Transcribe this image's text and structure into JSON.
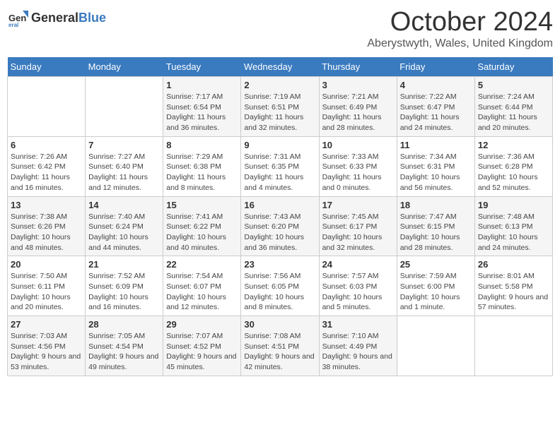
{
  "header": {
    "logo_general": "General",
    "logo_blue": "Blue",
    "month_title": "October 2024",
    "location": "Aberystwyth, Wales, United Kingdom"
  },
  "days_of_week": [
    "Sunday",
    "Monday",
    "Tuesday",
    "Wednesday",
    "Thursday",
    "Friday",
    "Saturday"
  ],
  "weeks": [
    [
      {
        "day": "",
        "detail": ""
      },
      {
        "day": "",
        "detail": ""
      },
      {
        "day": "1",
        "detail": "Sunrise: 7:17 AM\nSunset: 6:54 PM\nDaylight: 11 hours and 36 minutes."
      },
      {
        "day": "2",
        "detail": "Sunrise: 7:19 AM\nSunset: 6:51 PM\nDaylight: 11 hours and 32 minutes."
      },
      {
        "day": "3",
        "detail": "Sunrise: 7:21 AM\nSunset: 6:49 PM\nDaylight: 11 hours and 28 minutes."
      },
      {
        "day": "4",
        "detail": "Sunrise: 7:22 AM\nSunset: 6:47 PM\nDaylight: 11 hours and 24 minutes."
      },
      {
        "day": "5",
        "detail": "Sunrise: 7:24 AM\nSunset: 6:44 PM\nDaylight: 11 hours and 20 minutes."
      }
    ],
    [
      {
        "day": "6",
        "detail": "Sunrise: 7:26 AM\nSunset: 6:42 PM\nDaylight: 11 hours and 16 minutes."
      },
      {
        "day": "7",
        "detail": "Sunrise: 7:27 AM\nSunset: 6:40 PM\nDaylight: 11 hours and 12 minutes."
      },
      {
        "day": "8",
        "detail": "Sunrise: 7:29 AM\nSunset: 6:38 PM\nDaylight: 11 hours and 8 minutes."
      },
      {
        "day": "9",
        "detail": "Sunrise: 7:31 AM\nSunset: 6:35 PM\nDaylight: 11 hours and 4 minutes."
      },
      {
        "day": "10",
        "detail": "Sunrise: 7:33 AM\nSunset: 6:33 PM\nDaylight: 11 hours and 0 minutes."
      },
      {
        "day": "11",
        "detail": "Sunrise: 7:34 AM\nSunset: 6:31 PM\nDaylight: 10 hours and 56 minutes."
      },
      {
        "day": "12",
        "detail": "Sunrise: 7:36 AM\nSunset: 6:28 PM\nDaylight: 10 hours and 52 minutes."
      }
    ],
    [
      {
        "day": "13",
        "detail": "Sunrise: 7:38 AM\nSunset: 6:26 PM\nDaylight: 10 hours and 48 minutes."
      },
      {
        "day": "14",
        "detail": "Sunrise: 7:40 AM\nSunset: 6:24 PM\nDaylight: 10 hours and 44 minutes."
      },
      {
        "day": "15",
        "detail": "Sunrise: 7:41 AM\nSunset: 6:22 PM\nDaylight: 10 hours and 40 minutes."
      },
      {
        "day": "16",
        "detail": "Sunrise: 7:43 AM\nSunset: 6:20 PM\nDaylight: 10 hours and 36 minutes."
      },
      {
        "day": "17",
        "detail": "Sunrise: 7:45 AM\nSunset: 6:17 PM\nDaylight: 10 hours and 32 minutes."
      },
      {
        "day": "18",
        "detail": "Sunrise: 7:47 AM\nSunset: 6:15 PM\nDaylight: 10 hours and 28 minutes."
      },
      {
        "day": "19",
        "detail": "Sunrise: 7:48 AM\nSunset: 6:13 PM\nDaylight: 10 hours and 24 minutes."
      }
    ],
    [
      {
        "day": "20",
        "detail": "Sunrise: 7:50 AM\nSunset: 6:11 PM\nDaylight: 10 hours and 20 minutes."
      },
      {
        "day": "21",
        "detail": "Sunrise: 7:52 AM\nSunset: 6:09 PM\nDaylight: 10 hours and 16 minutes."
      },
      {
        "day": "22",
        "detail": "Sunrise: 7:54 AM\nSunset: 6:07 PM\nDaylight: 10 hours and 12 minutes."
      },
      {
        "day": "23",
        "detail": "Sunrise: 7:56 AM\nSunset: 6:05 PM\nDaylight: 10 hours and 8 minutes."
      },
      {
        "day": "24",
        "detail": "Sunrise: 7:57 AM\nSunset: 6:03 PM\nDaylight: 10 hours and 5 minutes."
      },
      {
        "day": "25",
        "detail": "Sunrise: 7:59 AM\nSunset: 6:00 PM\nDaylight: 10 hours and 1 minute."
      },
      {
        "day": "26",
        "detail": "Sunrise: 8:01 AM\nSunset: 5:58 PM\nDaylight: 9 hours and 57 minutes."
      }
    ],
    [
      {
        "day": "27",
        "detail": "Sunrise: 7:03 AM\nSunset: 4:56 PM\nDaylight: 9 hours and 53 minutes."
      },
      {
        "day": "28",
        "detail": "Sunrise: 7:05 AM\nSunset: 4:54 PM\nDaylight: 9 hours and 49 minutes."
      },
      {
        "day": "29",
        "detail": "Sunrise: 7:07 AM\nSunset: 4:52 PM\nDaylight: 9 hours and 45 minutes."
      },
      {
        "day": "30",
        "detail": "Sunrise: 7:08 AM\nSunset: 4:51 PM\nDaylight: 9 hours and 42 minutes."
      },
      {
        "day": "31",
        "detail": "Sunrise: 7:10 AM\nSunset: 4:49 PM\nDaylight: 9 hours and 38 minutes."
      },
      {
        "day": "",
        "detail": ""
      },
      {
        "day": "",
        "detail": ""
      }
    ]
  ]
}
